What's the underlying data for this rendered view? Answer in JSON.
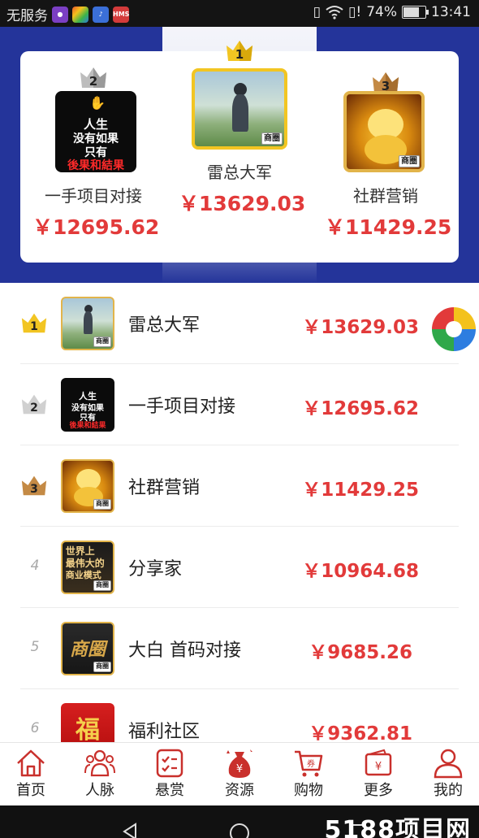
{
  "status_bar": {
    "carrier": "无服务",
    "battery_text": "74%",
    "battery_level": 0.74,
    "time": "13:41",
    "app_icons": [
      {
        "name": "app-icon-purple",
        "color": "#7b3fc4",
        "text": ""
      },
      {
        "name": "app-icon-multicolor",
        "color": "#e9572b",
        "text": ""
      },
      {
        "name": "app-icon-music",
        "color": "#3b6fd8",
        "text": ""
      },
      {
        "name": "app-icon-hms",
        "color": "#d43b3b",
        "text": "HMS"
      }
    ]
  },
  "podium": [
    {
      "rank": "2",
      "name": "一手项目对接",
      "amount": "￥12695.62",
      "avatar": "black-text",
      "crown_color": "#bdbdbd"
    },
    {
      "rank": "1",
      "name": "雷总大军",
      "amount": "￥13629.03",
      "avatar": "photo",
      "crown_color": "#f2c522"
    },
    {
      "rank": "3",
      "name": "社群营销",
      "amount": "￥11429.25",
      "avatar": "cat",
      "crown_color": "#c48a45"
    }
  ],
  "black_avatar_text": {
    "line1": "人生",
    "line2": "没有如果",
    "line3": "只有",
    "line4": "後果和結果"
  },
  "dark_avatar_text": {
    "line1": "世界上",
    "line2": "最伟大的",
    "line3": "商业模式"
  },
  "gold_avatar_text": "商圈",
  "red_avatar_text": "福",
  "tag_text": "商圈",
  "list": [
    {
      "rank": "1",
      "name": "雷总大军",
      "amount": "￥13629.03",
      "avatar": "photo",
      "crown": true,
      "crown_color": "#f2c522"
    },
    {
      "rank": "2",
      "name": "一手项目对接",
      "amount": "￥12695.62",
      "avatar": "black-text",
      "crown": true,
      "crown_color": "#bdbdbd"
    },
    {
      "rank": "3",
      "name": "社群营销",
      "amount": "￥11429.25",
      "avatar": "cat",
      "crown": true,
      "crown_color": "#c48a45"
    },
    {
      "rank": "4",
      "name": "分享家",
      "amount": "￥10964.68",
      "avatar": "dark-text",
      "crown": false
    },
    {
      "rank": "5",
      "name": "大白 首码对接",
      "amount": "￥9685.26",
      "avatar": "gold",
      "crown": false
    },
    {
      "rank": "6",
      "name": "福利社区",
      "amount": "￥9362.81",
      "avatar": "red",
      "crown": false
    }
  ],
  "tabs": [
    {
      "label": "首页",
      "icon": "home-icon"
    },
    {
      "label": "人脉",
      "icon": "contacts-icon"
    },
    {
      "label": "悬赏",
      "icon": "task-list-icon"
    },
    {
      "label": "资源",
      "icon": "money-bag-icon"
    },
    {
      "label": "购物",
      "icon": "shopping-cart-icon"
    },
    {
      "label": "更多",
      "icon": "wallet-icon"
    },
    {
      "label": "我的",
      "icon": "user-icon"
    }
  ],
  "watermark": "5188项目网",
  "colors": {
    "brand_blue": "#24349a",
    "accent_red": "#e23a3a",
    "gold": "#f2c522",
    "silver": "#bdbdbd",
    "bronze": "#c48a45"
  }
}
